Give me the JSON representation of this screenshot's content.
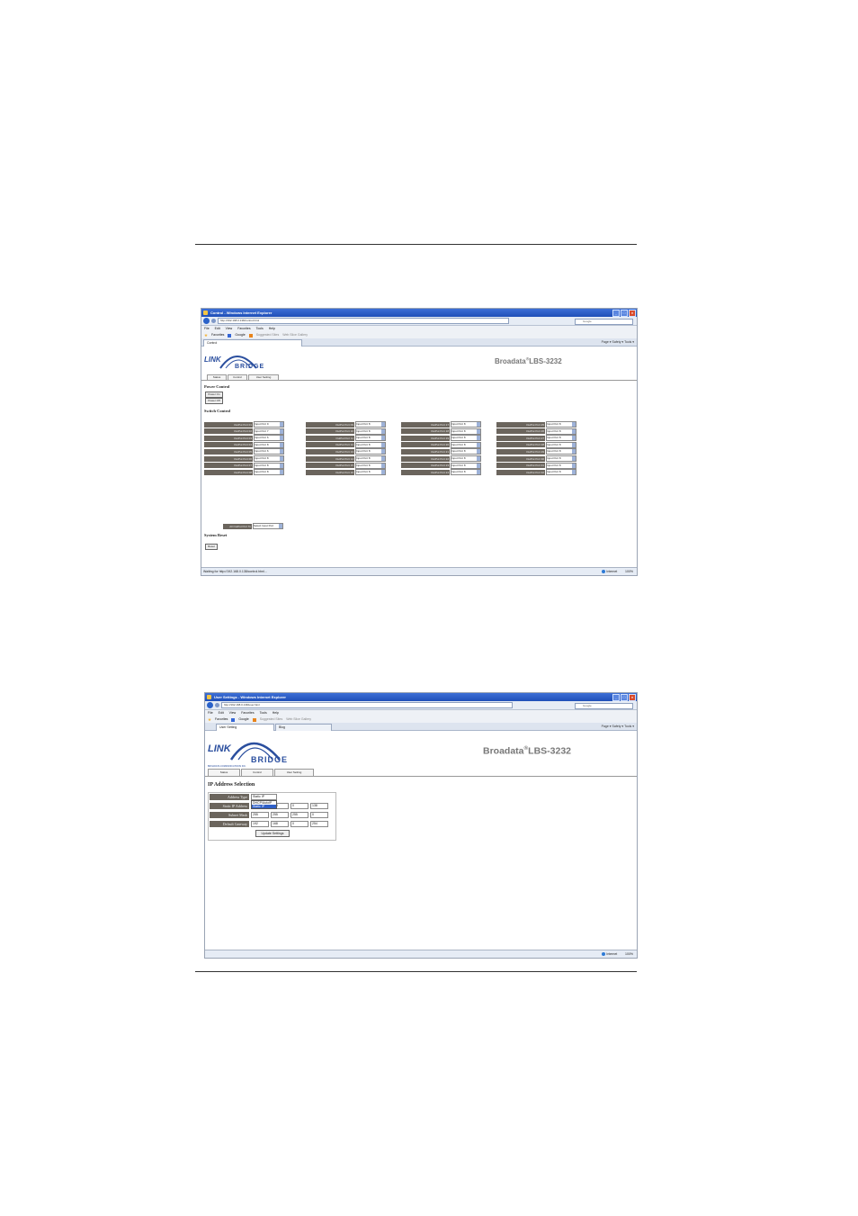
{
  "screenshot1": {
    "window_title": "Control - Windows Internet Explorer",
    "url": "http://192.168.0.138/control.html",
    "search_placeholder": "Google",
    "menu": [
      "File",
      "Edit",
      "View",
      "Favorites",
      "Tools",
      "Help"
    ],
    "favorites": [
      "Favorites",
      "Google",
      "Suggested Sites",
      "Web Slice Gallery"
    ],
    "tab_title": "Control",
    "tab_tools": "Page ▾  Safety ▾  Tools ▾",
    "logo_link": "LINK",
    "logo_bridge": "BRIDGE",
    "product": "Broadata",
    "product_sup": "®",
    "product_model": "LBS-3232",
    "nav_tabs": [
      "Status",
      "Control",
      "User Setting"
    ],
    "power_title": "Power Control",
    "power_buttons": [
      "Power On",
      "Power Off"
    ],
    "switch_title": "Switch Control",
    "columns": [
      {
        "ports": [
          {
            "label": "OutPut Port 01",
            "value": "Input Port 9"
          },
          {
            "label": "OutPut Port 02",
            "value": "Input Port 7"
          },
          {
            "label": "OutPut Port 03",
            "value": "Input Port 6"
          },
          {
            "label": "OutPut Port 04",
            "value": "Input Port 8"
          },
          {
            "label": "OutPut Port 05",
            "value": "Input Port 6"
          },
          {
            "label": "OutPut Port 06",
            "value": "Input Port 8"
          },
          {
            "label": "OutPut Port 07",
            "value": "Input Port 8"
          },
          {
            "label": "OutPut Port 08",
            "value": "Input Port 8"
          }
        ]
      },
      {
        "ports": [
          {
            "label": "OutPut Port 09",
            "value": "Input Port 8"
          },
          {
            "label": "OutPut Port 10",
            "value": "Input Port 8"
          },
          {
            "label": "OutPut Port 11",
            "value": "Input Port 8"
          },
          {
            "label": "OutPut Port 12",
            "value": "Input Port 8"
          },
          {
            "label": "OutPut Port 13",
            "value": "Input Port 8"
          },
          {
            "label": "OutPut Port 14",
            "value": "Input Port 8"
          },
          {
            "label": "OutPut Port 15",
            "value": "Input Port 8"
          },
          {
            "label": "OutPut Port 16",
            "value": "Input Port 8"
          }
        ]
      },
      {
        "ports": [
          {
            "label": "OutPut Port 17",
            "value": "Input Port 8"
          },
          {
            "label": "OutPut Port 18",
            "value": "Input Port 8"
          },
          {
            "label": "OutPut Port 19",
            "value": "Input Port 8"
          },
          {
            "label": "OutPut Port 20",
            "value": "Input Port 8"
          },
          {
            "label": "OutPut Port 21",
            "value": "Input Port 8"
          },
          {
            "label": "OutPut Port 22",
            "value": "Input Port 8"
          },
          {
            "label": "OutPut Port 23",
            "value": "Input Port 8"
          },
          {
            "label": "OutPut Port 24",
            "value": "Input Port 8"
          }
        ]
      },
      {
        "ports": [
          {
            "label": "OutPut Port 25",
            "value": "Input Port 8"
          },
          {
            "label": "OutPut Port 26",
            "value": "Input Port 8"
          },
          {
            "label": "OutPut Port 27",
            "value": "Input Port 8"
          },
          {
            "label": "OutPut Port 28",
            "value": "Input Port 8"
          },
          {
            "label": "OutPut Port 29",
            "value": "Input Port 8"
          },
          {
            "label": "OutPut Port 30",
            "value": "Input Port 8"
          },
          {
            "label": "OutPut Port 31",
            "value": "Input Port 8"
          },
          {
            "label": "OutPut Port 32",
            "value": "Input Port 8"
          }
        ]
      }
    ],
    "all_label": "All OutPut Port To",
    "all_value": "Select Input Port",
    "reset_title": "System Reset",
    "reset_button": "Reset",
    "status_text": "Waiting for http://192.168.0.138/control.html...",
    "status_zone": "Internet",
    "status_zoom": "100%"
  },
  "screenshot2": {
    "window_title": "User Settings - Windows Internet Explorer",
    "url": "http://192.168.0.138/user.html",
    "search_placeholder": "Google",
    "menu": [
      "File",
      "Edit",
      "View",
      "Favorites",
      "Tools",
      "Help"
    ],
    "favorites": [
      "Favorites",
      "Google",
      "Suggested Sites",
      "Web Slice Gallery"
    ],
    "tab_titles": [
      "User Setting",
      "Blog"
    ],
    "tab_tools": "Page ▾  Safety ▾  Tools ▾",
    "logo_link": "LINK",
    "logo_bridge": "BRIDGE",
    "logo_tagline": "BROADATA COMMUNICATIONS INC.",
    "product": "Broadata",
    "product_sup": "®",
    "product_model": "LBS-3232",
    "nav_tabs": [
      "Status",
      "Control",
      "User Setting"
    ],
    "ip_title": "IP Address Selection",
    "address_type_label": "Address Type",
    "address_type_value": "Static IP",
    "address_type_options": [
      "DHCP/AutoIP",
      "Static IP"
    ],
    "static_ip_label": "Static IP Address",
    "static_ip": [
      "192",
      "168",
      "0",
      "138"
    ],
    "subnet_label": "Subnet Mask",
    "subnet": [
      "255",
      "255",
      "255",
      "0"
    ],
    "gateway_label": "Default Gateway",
    "gateway": [
      "192",
      "168",
      "0",
      "254"
    ],
    "update_button": "Update Settings",
    "status_zone": "Internet",
    "status_zoom": "100%"
  },
  "colors": {
    "titlebar": "#2a5ccc",
    "label_bg": "#6b655d",
    "brand_blue": "#2a4e9e",
    "product_gray": "#777777"
  }
}
